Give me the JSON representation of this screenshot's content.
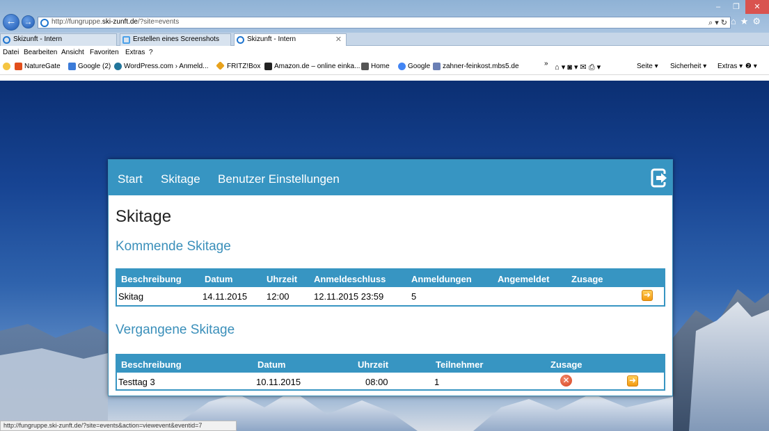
{
  "browser": {
    "address_url_prefix": "http://fungruppe.",
    "address_url_domain": "ski-zunft.de",
    "address_url_suffix": "/?site=events",
    "address_tools": "⌕ ▾ ↻",
    "right_icons": "⌂★⚙",
    "window_controls": {
      "minimize": "–",
      "maximize": "❐",
      "close": "✕"
    },
    "tabs": [
      {
        "label": "Skizunft - Intern"
      },
      {
        "label": "Erstellen eines Screenshots"
      },
      {
        "label": "Skizunft - Intern",
        "close": "✕"
      }
    ],
    "menu": [
      "Datei",
      "Bearbeiten",
      "Ansicht",
      "Favoriten",
      "Extras",
      "?"
    ],
    "favorites": [
      "NatureGate",
      "Google (2)",
      "WordPress.com › Anmeld...",
      "FRITZ!Box",
      "Amazon.de – online einka...",
      "Home",
      "Google",
      "zahner-feinkost.mbs5.de"
    ],
    "commands": {
      "overflow": "»",
      "icons": "⌂ ▾  ◙ ▾ ✉ ⎙ ▾",
      "page": "Seite ▾",
      "security": "Sicherheit ▾",
      "extras": "Extras ▾",
      "help": "❷ ▾"
    },
    "status_text": "http://fungruppe.ski-zunft.de/?site=events&action=viewevent&eventid=7"
  },
  "app": {
    "nav": [
      "Start",
      "Skitage",
      "Benutzer Einstellungen"
    ],
    "page_title": "Skitage",
    "upcoming": {
      "title": "Kommende Skitage",
      "headers": [
        "Beschreibung",
        "Datum",
        "Uhrzeit",
        "Anmeldeschluss",
        "Anmeldungen",
        "Angemeldet",
        "Zusage"
      ],
      "rows": [
        {
          "beschreibung": "Skitag",
          "datum": "14.11.2015",
          "uhrzeit": "12:00",
          "anmeldeschluss": "12.11.2015 23:59",
          "anmeldungen": "5",
          "angemeldet": "",
          "zusage": ""
        }
      ]
    },
    "past": {
      "title": "Vergangene Skitage",
      "headers": [
        "Beschreibung",
        "Datum",
        "Uhrzeit",
        "Teilnehmer",
        "Zusage"
      ],
      "rows": [
        {
          "beschreibung": "Testtag 3",
          "datum": "10.11.2015",
          "uhrzeit": "08:00",
          "teilnehmer": "1",
          "zusage_icon": "x-circle-icon"
        }
      ]
    }
  },
  "colors": {
    "accent": "#3795c2",
    "section_title": "#3a8fba",
    "arrow_icon": "#f39a12",
    "decline_icon": "#d7431f"
  }
}
